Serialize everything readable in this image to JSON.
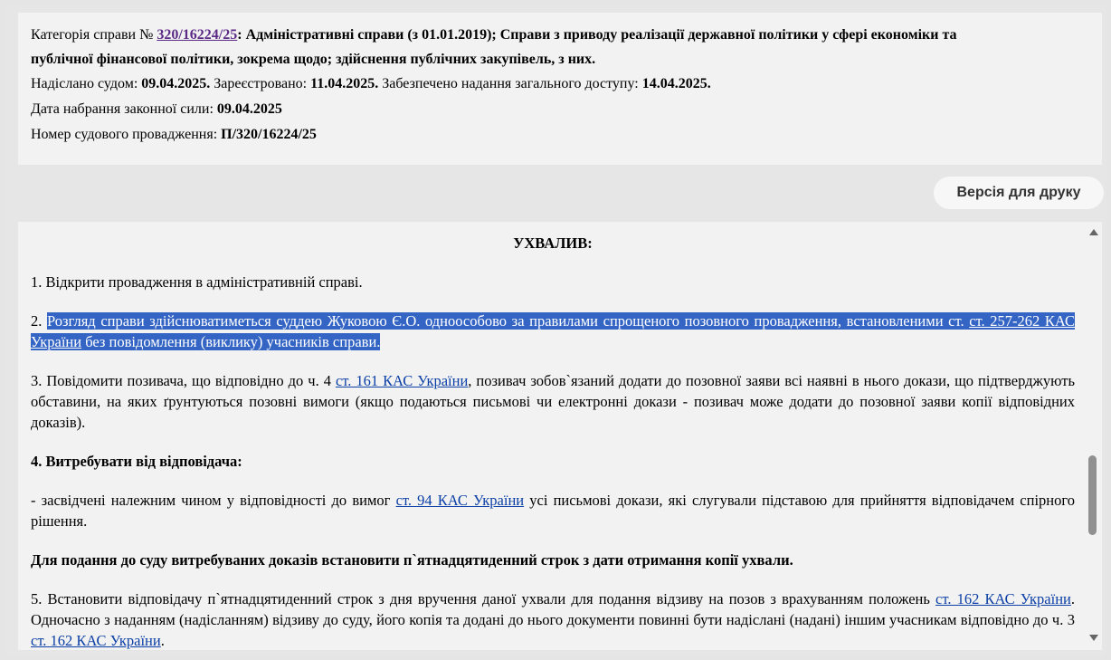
{
  "info": {
    "category_label": "Категорія справи №",
    "case_number": "320/16224/25",
    "category_text": ": Адміністративні справи (з 01.01.2019); Справи з приводу реалізації державної політики у сфері економіки та",
    "category_text_2": "публічної фінансової політики, зокрема щодо; здійснення публічних закупівель, з них.",
    "sent_label": "Надіслано судом:",
    "sent_date": "09.04.2025.",
    "registered_label": "Зареєстровано:",
    "registered_date": "11.04.2025.",
    "access_label": "Забезпечено надання загального доступу:",
    "access_date": "14.04.2025.",
    "force_label": "Дата набрання законної сили:",
    "force_date": "09.04.2025",
    "proceeding_label": "Номер судового провадження:",
    "proceeding_number": "П/320/16224/25"
  },
  "print_button": "Версія для друку",
  "document": {
    "title": "УХВАЛИВ:",
    "p1": "1. Відкрити провадження в адміністративній справі.",
    "p2_num": "2. ",
    "p2_text_a": "Розгляд справи здійснюватиметься суддею Жуковою Є.О. одноособово за правилами спрощеного позовного провадження, встановленими ст. ",
    "p2_link": "ст. 257-262 КАС України",
    "p2_text_b": " без повідомлення (виклику) учасників справи.",
    "p3_a": "3. Повідомити позивача, що відповідно до ч. 4 ",
    "p3_link": "ст. 161 КАС України",
    "p3_b": ", позивач зобов`язаний додати до позовної заяви всі наявні в нього докази, що підтверджують обставини, на яких ґрунтуються позовні вимоги (якщо подаються письмові чи електронні докази - позивач може додати до позовної заяви копії відповідних доказів).",
    "p4": "4. Витребувати від відповідача:",
    "p5_a": "- засвідчені належним чином у відповідності до вимог ",
    "p5_link": "ст. 94 КАС України",
    "p5_b": " усі письмові докази, які слугували підставою для прийняття відповідачем спірного рішення.",
    "p6": "Для подання до суду витребуваних доказів встановити п`ятнадцятиденний строк з дати отримання копії ухвали.",
    "p7_a": "5. Встановити відповідачу п`ятнадцятиденний строк з дня вручення даної ухвали для подання відзиву на позов з врахуванням положень ",
    "p7_link": "ст. 162 КАС України",
    "p7_b": ". Одночасно з наданням (надісланням) відзиву до суду, його копія та додані до нього документи повинні бути надіслані (надані) іншим учасникам відповідно до ч. 3 ",
    "p7_link2": "ст. 162 КАС України",
    "p7_c": "."
  }
}
